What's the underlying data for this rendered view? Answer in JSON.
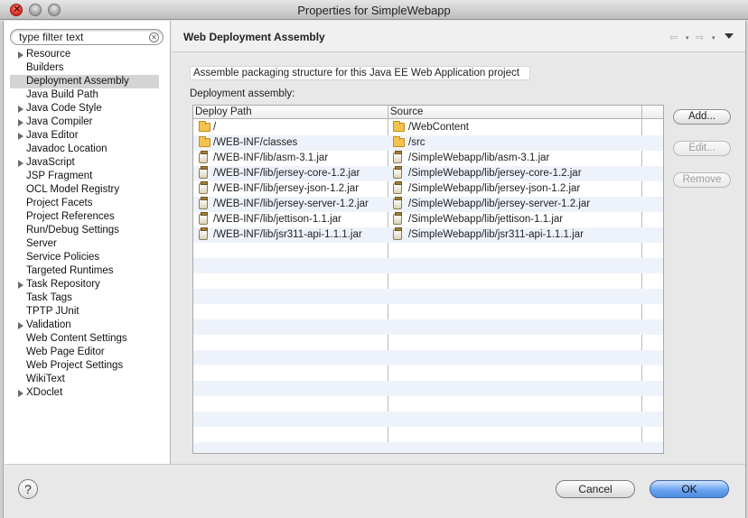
{
  "window": {
    "title": "Properties for SimpleWebapp"
  },
  "filter": {
    "placeholder": "type filter text",
    "value": "type filter text"
  },
  "tree": {
    "items": [
      {
        "label": "Resource",
        "expandable": true,
        "selected": false
      },
      {
        "label": "Builders",
        "expandable": false,
        "selected": false
      },
      {
        "label": "Deployment Assembly",
        "expandable": false,
        "selected": true
      },
      {
        "label": "Java Build Path",
        "expandable": false,
        "selected": false
      },
      {
        "label": "Java Code Style",
        "expandable": true,
        "selected": false
      },
      {
        "label": "Java Compiler",
        "expandable": true,
        "selected": false
      },
      {
        "label": "Java Editor",
        "expandable": true,
        "selected": false
      },
      {
        "label": "Javadoc Location",
        "expandable": false,
        "selected": false
      },
      {
        "label": "JavaScript",
        "expandable": true,
        "selected": false
      },
      {
        "label": "JSP Fragment",
        "expandable": false,
        "selected": false
      },
      {
        "label": "OCL Model Registry",
        "expandable": false,
        "selected": false
      },
      {
        "label": "Project Facets",
        "expandable": false,
        "selected": false
      },
      {
        "label": "Project References",
        "expandable": false,
        "selected": false
      },
      {
        "label": "Run/Debug Settings",
        "expandable": false,
        "selected": false
      },
      {
        "label": "Server",
        "expandable": false,
        "selected": false
      },
      {
        "label": "Service Policies",
        "expandable": false,
        "selected": false
      },
      {
        "label": "Targeted Runtimes",
        "expandable": false,
        "selected": false
      },
      {
        "label": "Task Repository",
        "expandable": true,
        "selected": false
      },
      {
        "label": "Task Tags",
        "expandable": false,
        "selected": false
      },
      {
        "label": "TPTP JUnit",
        "expandable": false,
        "selected": false
      },
      {
        "label": "Validation",
        "expandable": true,
        "selected": false
      },
      {
        "label": "Web Content Settings",
        "expandable": false,
        "selected": false
      },
      {
        "label": "Web Page Editor",
        "expandable": false,
        "selected": false
      },
      {
        "label": "Web Project Settings",
        "expandable": false,
        "selected": false
      },
      {
        "label": "WikiText",
        "expandable": false,
        "selected": false
      },
      {
        "label": "XDoclet",
        "expandable": true,
        "selected": false
      }
    ]
  },
  "page": {
    "title": "Web Deployment Assembly",
    "description": "Assemble packaging structure for this Java EE Web Application project",
    "section_label": "Deployment assembly:",
    "nav": {
      "back": "⇦",
      "forward": "⇨",
      "dropdown": "▾"
    }
  },
  "table": {
    "headers": [
      "Deploy Path",
      "Source"
    ],
    "rows": [
      {
        "deploy": "/",
        "source": "/WebContent",
        "icon": "folder-icon"
      },
      {
        "deploy": "/WEB-INF/classes",
        "source": "/src",
        "icon": "folder-icon"
      },
      {
        "deploy": "/WEB-INF/lib/asm-3.1.jar",
        "source": "/SimpleWebapp/lib/asm-3.1.jar",
        "icon": "jar-icon"
      },
      {
        "deploy": "/WEB-INF/lib/jersey-core-1.2.jar",
        "source": "/SimpleWebapp/lib/jersey-core-1.2.jar",
        "icon": "jar-icon"
      },
      {
        "deploy": "/WEB-INF/lib/jersey-json-1.2.jar",
        "source": "/SimpleWebapp/lib/jersey-json-1.2.jar",
        "icon": "jar-icon"
      },
      {
        "deploy": "/WEB-INF/lib/jersey-server-1.2.jar",
        "source": "/SimpleWebapp/lib/jersey-server-1.2.jar",
        "icon": "jar-icon"
      },
      {
        "deploy": "/WEB-INF/lib/jettison-1.1.jar",
        "source": "/SimpleWebapp/lib/jettison-1.1.jar",
        "icon": "jar-icon"
      },
      {
        "deploy": "/WEB-INF/lib/jsr311-api-1.1.1.jar",
        "source": "/SimpleWebapp/lib/jsr311-api-1.1.1.jar",
        "icon": "jar-icon"
      }
    ]
  },
  "buttons": {
    "add": "Add...",
    "edit": "Edit...",
    "remove": "Remove",
    "cancel": "Cancel",
    "ok": "OK",
    "help": "?"
  },
  "colors": {
    "ok_button": "#6aa3ee",
    "row_alt": "#eef3fb",
    "selected_tree": "#d4d4d4"
  }
}
